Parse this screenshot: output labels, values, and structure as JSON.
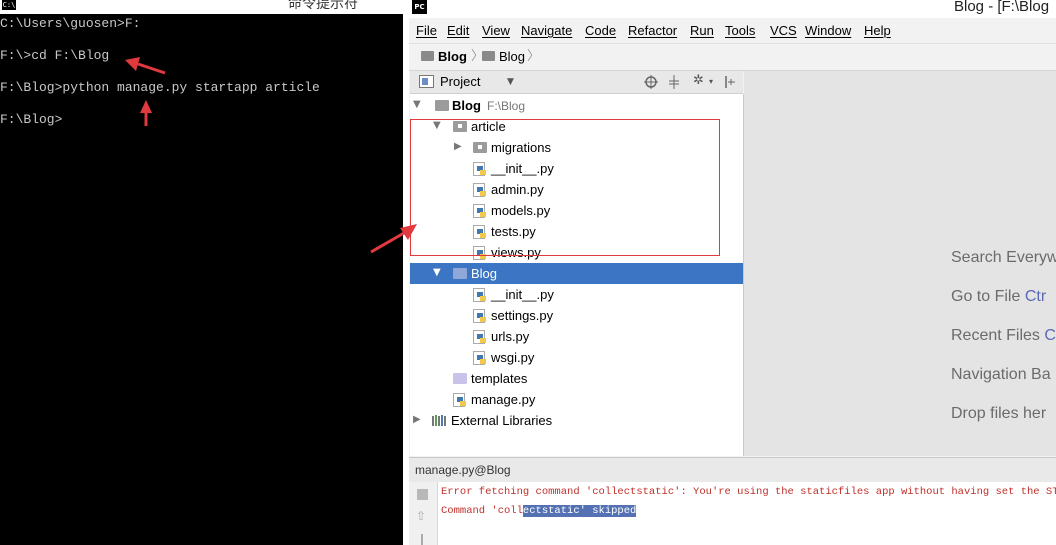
{
  "cmd": {
    "title": "命令提示符",
    "icon_text": "C:\\",
    "lines": [
      "C:\\Users\\guosen>F:",
      "F:\\>cd F:\\Blog",
      "F:\\Blog>python manage.py startapp article",
      "F:\\Blog>"
    ]
  },
  "ide": {
    "logo_text": "PC",
    "window_title": "Blog - [F:\\Blog",
    "menu": [
      "File",
      "Edit",
      "View",
      "Navigate",
      "Code",
      "Refactor",
      "Run",
      "Tools",
      "VCS",
      "Window",
      "Help"
    ],
    "breadcrumb": [
      "Blog",
      "Blog"
    ],
    "project_panel": {
      "dropdown": "Project",
      "tree": [
        {
          "label": "Blog",
          "sub": "F:\\Blog"
        },
        {
          "label": "article"
        },
        {
          "label": "migrations"
        },
        {
          "label": "__init__.py"
        },
        {
          "label": "admin.py"
        },
        {
          "label": "models.py"
        },
        {
          "label": "tests.py"
        },
        {
          "label": "views.py"
        },
        {
          "label": "Blog"
        },
        {
          "label": "__init__.py"
        },
        {
          "label": "settings.py"
        },
        {
          "label": "urls.py"
        },
        {
          "label": "wsgi.py"
        },
        {
          "label": "templates"
        },
        {
          "label": "manage.py"
        },
        {
          "label": "External Libraries"
        }
      ]
    },
    "welcome": [
      {
        "text": "Search Everyw",
        "key": ""
      },
      {
        "text": "Go to File ",
        "key": "Ctr"
      },
      {
        "text": "Recent Files ",
        "key": "C"
      },
      {
        "text": "Navigation Ba",
        "key": ""
      },
      {
        "text": "Drop files her",
        "key": ""
      }
    ],
    "run": {
      "title": "manage.py@Blog",
      "line1": "Error fetching command 'collectstatic': You're using the staticfiles app without having set the STATIC_",
      "line2_plain": "Command 'coll",
      "line2_highlight": "ectstatic' skipped"
    }
  },
  "colors": {
    "cmd_bg": "#000000",
    "selection": "#3b75c4",
    "annotation": "#e0393e",
    "console_error": "#c0302a"
  }
}
